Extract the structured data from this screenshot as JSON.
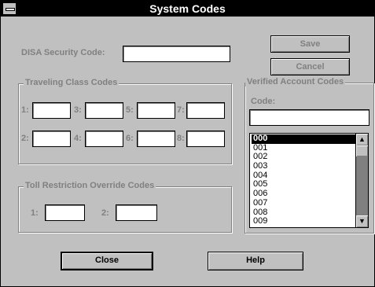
{
  "window": {
    "title": "System Codes"
  },
  "disa": {
    "label": "DISA Security Code:",
    "value": ""
  },
  "buttons": {
    "save": "Save",
    "cancel": "Cancel",
    "close": "Close",
    "help": "Help"
  },
  "traveling": {
    "legend": "Traveling Class Codes",
    "fields": [
      {
        "label": "1:",
        "value": ""
      },
      {
        "label": "3:",
        "value": ""
      },
      {
        "label": "5:",
        "value": ""
      },
      {
        "label": "7:",
        "value": ""
      },
      {
        "label": "2:",
        "value": ""
      },
      {
        "label": "4:",
        "value": ""
      },
      {
        "label": "6:",
        "value": ""
      },
      {
        "label": "8:",
        "value": ""
      }
    ]
  },
  "toll": {
    "legend": "Toll Restriction Override Codes",
    "fields": [
      {
        "label": "1:",
        "value": ""
      },
      {
        "label": "2:",
        "value": ""
      }
    ]
  },
  "verified": {
    "legend": "Verified Account Codes",
    "code_label": "Code:",
    "code_value": "",
    "items": [
      "000",
      "001",
      "002",
      "003",
      "004",
      "005",
      "006",
      "007",
      "008",
      "009"
    ],
    "selected": "000"
  },
  "icons": {
    "system_menu": "system-menu-icon",
    "scroll_up": "up-arrow-icon",
    "scroll_down": "down-arrow-icon"
  }
}
